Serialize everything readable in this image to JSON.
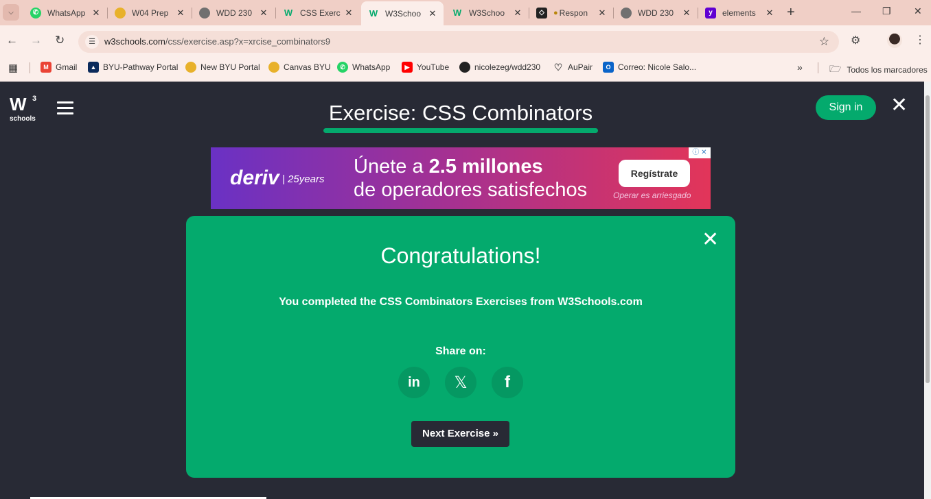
{
  "browser": {
    "tabs": [
      {
        "label": "WhatsApp",
        "icon": "whatsapp-icon",
        "active": false
      },
      {
        "label": "W04 Prep",
        "icon": "canvas-icon",
        "active": false
      },
      {
        "label": "WDD 230",
        "icon": "globe-icon",
        "active": false
      },
      {
        "label": "CSS Exerc",
        "icon": "w3schools-icon",
        "active": false
      },
      {
        "label": "W3Schoo",
        "icon": "w3schools-icon",
        "active": true
      },
      {
        "label": "W3Schoo",
        "icon": "w3schools-icon",
        "active": false
      },
      {
        "label": "Respon",
        "icon": "codepen-icon",
        "active": false
      },
      {
        "label": "WDD 230",
        "icon": "globe-icon",
        "active": false
      },
      {
        "label": "elements",
        "icon": "yahoo-icon",
        "active": false
      }
    ],
    "url_host": "w3schools.com",
    "url_path": "/css/exercise.asp?x=xrcise_combinators9",
    "bookmarks": [
      {
        "label": "Gmail",
        "icon": "gmail-icon"
      },
      {
        "label": "BYU-Pathway Portal",
        "icon": "byu-pathway-icon"
      },
      {
        "label": "New BYU Portal",
        "icon": "canvas-icon"
      },
      {
        "label": "Canvas BYU",
        "icon": "canvas-icon"
      },
      {
        "label": "WhatsApp",
        "icon": "whatsapp-icon"
      },
      {
        "label": "YouTube",
        "icon": "youtube-icon"
      },
      {
        "label": "nicolezeg/wdd230",
        "icon": "github-icon"
      },
      {
        "label": "AuPair",
        "icon": "heart-icon"
      },
      {
        "label": "Correo: Nicole Salo...",
        "icon": "outlook-icon"
      }
    ],
    "all_bookmarks_label": "Todos los marcadores"
  },
  "page": {
    "logo_text": "W",
    "logo_sup": "3",
    "logo_small": "schools",
    "title": "Exercise: CSS Combinators",
    "signin_label": "Sign in",
    "ad": {
      "brand": "deriv",
      "years": "25years",
      "line1_prefix": "Únete a ",
      "line1_bold": "2.5 millones",
      "line2": "de operadores satisfechos",
      "cta": "Regístrate",
      "risk": "Operar es arriesgado"
    },
    "modal": {
      "heading": "Congratulations!",
      "message": "You completed the CSS Combinators Exercises from W3Schools.com",
      "share_label": "Share on:",
      "next_label": "Next Exercise »"
    }
  },
  "colors": {
    "accent": "#04aa6d",
    "page_bg": "#282a35",
    "tabstrip_bg": "#f0cfc6",
    "toolbar_bg": "#fbeeea"
  }
}
